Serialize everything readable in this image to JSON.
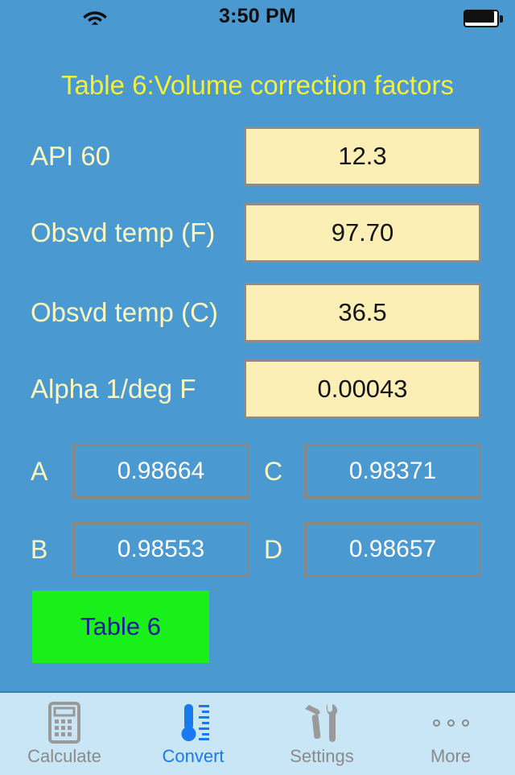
{
  "status_bar": {
    "time": "3:50 PM",
    "wifi_icon": "wifi-icon",
    "battery_icon": "battery-full-icon"
  },
  "header": {
    "title": "Table 6:Volume correction factors",
    "title_color": "#f5ee3c"
  },
  "theme": {
    "background": "#4a9ad1",
    "input_background": "#fbefb6",
    "input_border": "#8e8c8a",
    "input_text": "#141414",
    "label_color": "#faf7c0",
    "result_text": "#ffffff",
    "result_border": "#8a8684",
    "button_background": "#19f019",
    "button_text": "#1c1c9e",
    "tabbar_background": "#c9e6f7",
    "tab_active_color": "#1979f0",
    "tab_inactive_color": "#8a8a8a"
  },
  "form": {
    "fields": [
      {
        "label": "API 60",
        "value": "12.3"
      },
      {
        "label": "Obsvd temp (F)",
        "value": "97.70"
      },
      {
        "label": "Obsvd temp (C)",
        "value": "36.5"
      },
      {
        "label": "Alpha 1/deg F",
        "value": "0.00043"
      }
    ]
  },
  "results": {
    "items": [
      {
        "label": "A",
        "value": "0.98664"
      },
      {
        "label": "B",
        "value": "0.98553"
      },
      {
        "label": "C",
        "value": "0.98371"
      },
      {
        "label": "D",
        "value": "0.98657"
      }
    ]
  },
  "actions": {
    "table_button_label": "Table 6"
  },
  "tab_bar": {
    "items": [
      {
        "label": "Calculate",
        "icon": "calculator-icon",
        "active": false
      },
      {
        "label": "Convert",
        "icon": "thermometer-icon",
        "active": true
      },
      {
        "label": "Settings",
        "icon": "tools-icon",
        "active": false
      },
      {
        "label": "More",
        "icon": "three-dots-icon",
        "active": false
      }
    ]
  }
}
